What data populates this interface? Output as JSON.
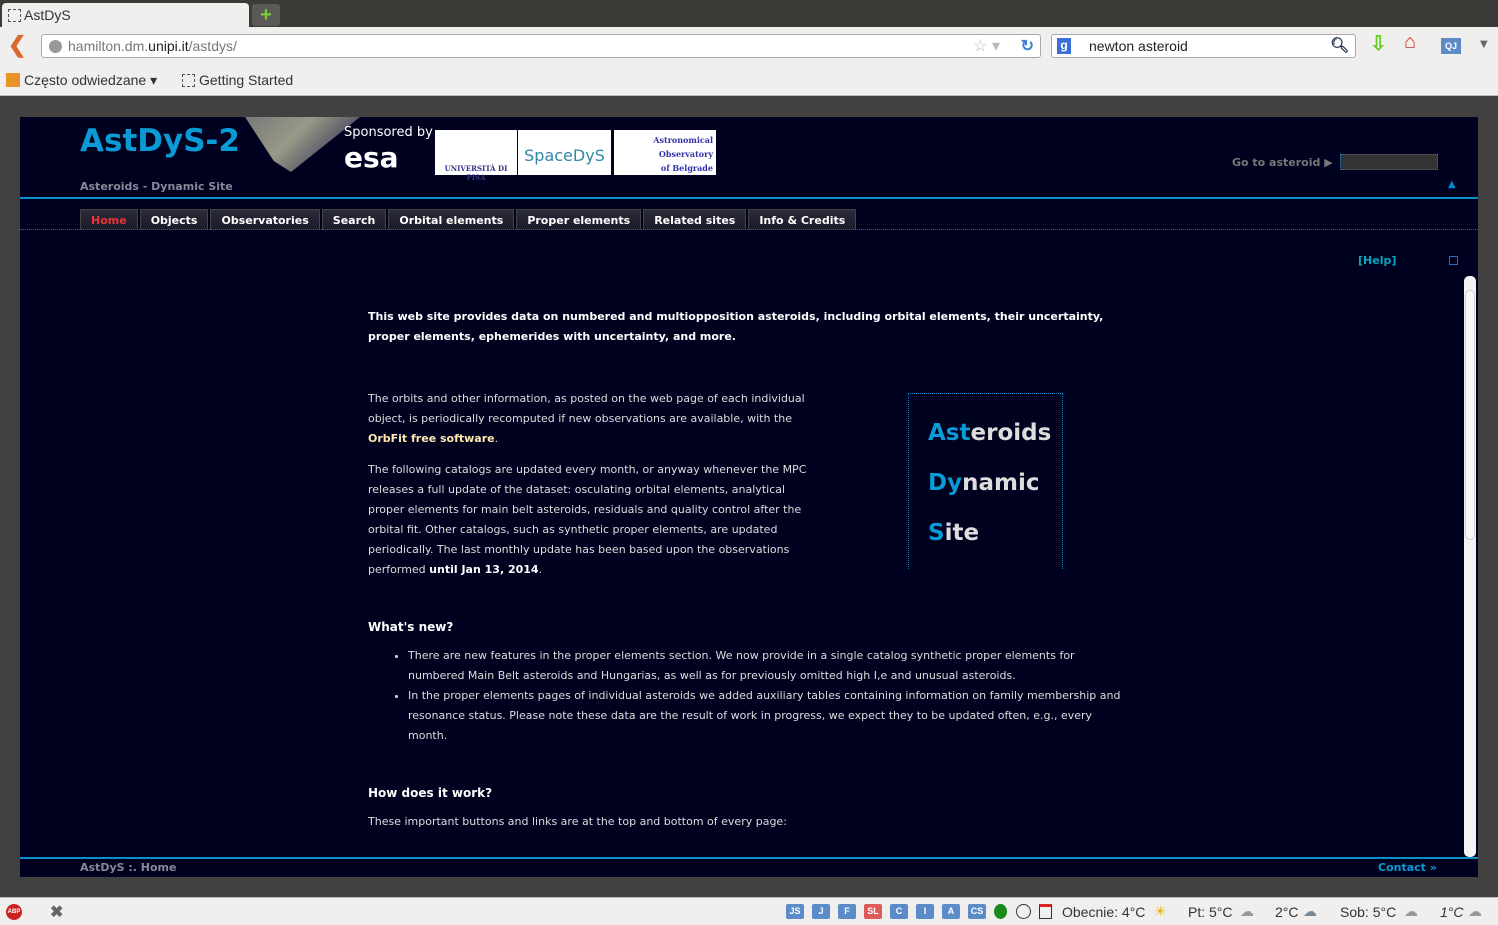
{
  "browser": {
    "tab_title": "AstDyS",
    "url_prefix": "hamilton.dm.",
    "url_domain": "unipi.it",
    "url_path": "/astdys/",
    "search_value": "newton asteroid",
    "bookmarks": [
      {
        "label": "Często odwiedzane ▾"
      },
      {
        "label": "Getting Started"
      }
    ]
  },
  "header": {
    "logo": "AstDyS-2",
    "subtitle": "Asteroids - Dynamic Site",
    "sponsored": "Sponsored by",
    "esa": "esa",
    "pisa": "UNIVERSITÀ DI PISA",
    "spacedys": "SpaceDyS",
    "belgrade": [
      "Astronomical",
      "Observatory",
      "of Belgrade"
    ],
    "goto_label": "Go to asteroid ▶",
    "goto_value": ""
  },
  "menu": [
    {
      "label": "Home",
      "active": true
    },
    {
      "label": "Objects"
    },
    {
      "label": "Observatories"
    },
    {
      "label": "Search"
    },
    {
      "label": "Orbital elements"
    },
    {
      "label": "Proper elements"
    },
    {
      "label": "Related sites"
    },
    {
      "label": "Info & Credits"
    }
  ],
  "help": "[Help]",
  "content": {
    "lead": "This web site provides data on numbered and multiopposition asteroids, including orbital elements, their uncertainty, proper elements, ephemerides with uncertainty, and more.",
    "p1a": "The orbits and other information, as posted on the web page of each individual object, is periodically recomputed if new observations are available, with the ",
    "p1link": "OrbFit free software",
    "p1b": ".",
    "p2a": "The following catalogs are updated every month, or anyway whenever the MPC releases a full update of the dataset: osculating orbital elements, analytical proper elements for main belt asteroids, residuals and quality control after the orbital fit. Other catalogs, such as synthetic proper elements, are updated periodically. The last monthly update has been based upon the observations performed ",
    "p2bold": "until Jan 13, 2014",
    "p2b": ".",
    "whatsnew": "What's new?",
    "news": [
      "There are new features in the proper elements section. We now provide in a single catalog synthetic proper elements for numbered Main Belt asteroids and Hungarias, as well as for previously omitted high I,e and unusual asteroids.",
      "In the proper elements pages of individual asteroids we added auxiliary tables containing information on family membership and resonance status. Please note these data are the result of work in progress, we expect they to be updated often, e.g., every month."
    ],
    "howworks": "How does it work?",
    "how_p": "These important buttons and links are at the top and bottom of every page:"
  },
  "sidebox": [
    {
      "a": "Ast",
      "b": "eroids"
    },
    {
      "a": "Dy",
      "b": "namic"
    },
    {
      "a": "S",
      "b": "ite"
    }
  ],
  "footer": {
    "crumb": "AstDyS :. Home",
    "contact": "Contact »"
  },
  "statusbar": {
    "buttons": [
      "JS",
      "J",
      "F",
      "SL",
      "C",
      "I",
      "A",
      "CS"
    ],
    "weather": [
      "Obecnie: 4°C",
      "Pt: 5°C",
      "2°C",
      "Sob: 5°C",
      "1°C"
    ]
  },
  "colors": {
    "accent": "#0a9ad6",
    "background": "#00001f",
    "active_tab": "#ee3333"
  }
}
